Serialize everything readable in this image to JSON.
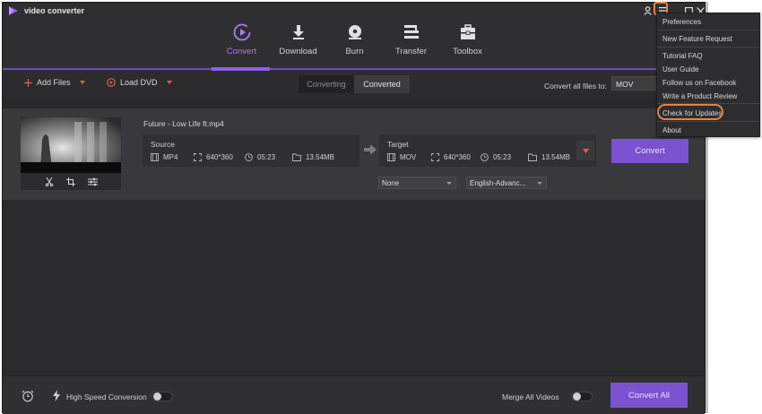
{
  "app": {
    "title": "video converter"
  },
  "nav": {
    "tabs": [
      {
        "label": "Convert",
        "icon": "convert-icon",
        "active": true
      },
      {
        "label": "Download",
        "icon": "download-icon",
        "active": false
      },
      {
        "label": "Burn",
        "icon": "burn-icon",
        "active": false
      },
      {
        "label": "Transfer",
        "icon": "transfer-icon",
        "active": false
      },
      {
        "label": "Toolbox",
        "icon": "toolbox-icon",
        "active": false
      }
    ]
  },
  "toolbar": {
    "add_files": "Add Files",
    "load_dvd": "Load DVD",
    "tab_converting": "Converting",
    "tab_converted": "Converted",
    "convert_all_to_label": "Convert all files to:",
    "convert_all_to_value": "MOV"
  },
  "file": {
    "name": "Future - Low Life ft.mp4",
    "source": {
      "title": "Source",
      "format": "MP4",
      "resolution": "640*360",
      "duration": "05:23",
      "size": "13.54MB"
    },
    "target": {
      "title": "Target",
      "format": "MOV",
      "resolution": "640*360",
      "duration": "05:23",
      "size": "13.54MB"
    },
    "convert_label": "Convert",
    "subtitle_select": "None",
    "audio_select": "English-Advanc..."
  },
  "footer": {
    "high_speed_label": "High Speed Conversion",
    "high_speed_on": false,
    "merge_label": "Merge All Videos",
    "merge_on": false,
    "convert_all_label": "Convert All"
  },
  "menu": {
    "items": [
      "Preferences",
      "New Feature Request",
      "Tutorial FAQ",
      "User Guide",
      "Follow us on Facebook",
      "Write a Product Review",
      "Check for Updates",
      "About"
    ],
    "highlighted": "Check for Updates"
  },
  "colors": {
    "accent": "#7b52cf",
    "nav_active": "#a47bf5",
    "highlight_ring": "#e8813a",
    "caret_red": "#e05a5a"
  }
}
